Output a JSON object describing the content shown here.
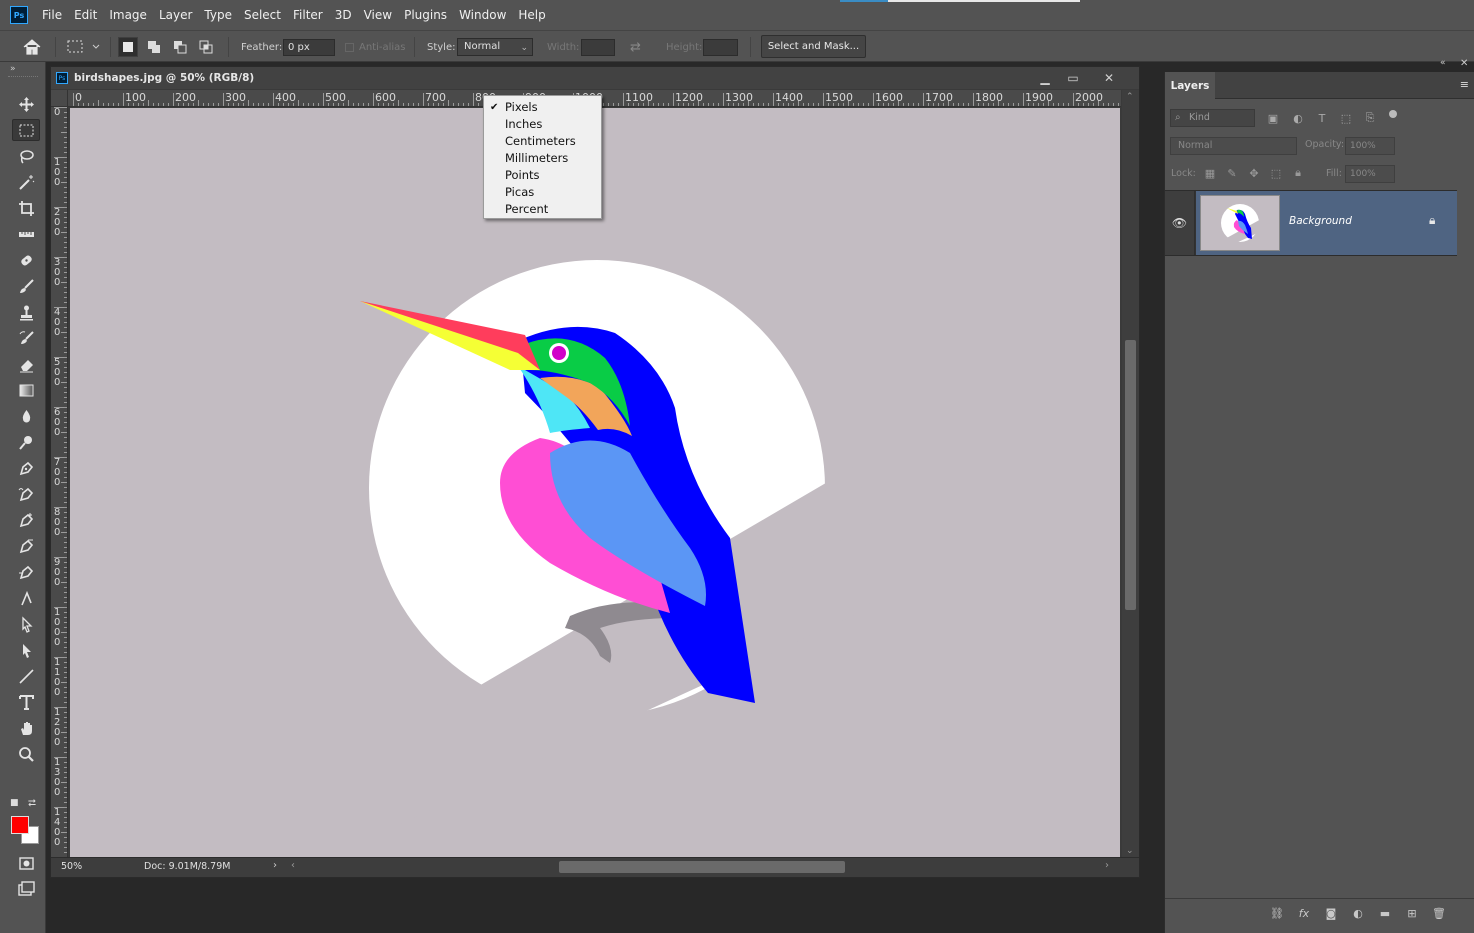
{
  "app": {
    "logo": "Ps"
  },
  "menu": [
    "File",
    "Edit",
    "Image",
    "Layer",
    "Type",
    "Select",
    "Filter",
    "3D",
    "View",
    "Plugins",
    "Window",
    "Help"
  ],
  "options": {
    "feather_label": "Feather:",
    "feather_value": "0 px",
    "antialias_label": "Anti-alias",
    "style_label": "Style:",
    "style_value": "Normal",
    "width_label": "Width:",
    "height_label": "Height:",
    "select_mask_label": "Select and Mask..."
  },
  "document": {
    "title": "birdshapes.jpg @ 50% (RGB/8)",
    "icon": "Ps",
    "zoom": "50%",
    "doc_size": "Doc: 9.01M/8.79M"
  },
  "ruler": {
    "top_labels": [
      "0",
      "100",
      "200",
      "300",
      "400",
      "500",
      "600",
      "700",
      "800",
      "900",
      "1000",
      "1100",
      "1200",
      "1300",
      "1400",
      "1500",
      "1600",
      "1700",
      "1800",
      "1900",
      "2000"
    ],
    "left_labels": [
      "0",
      "100",
      "200",
      "300",
      "400",
      "500",
      "600",
      "700",
      "800",
      "900",
      "1000",
      "1100",
      "1200",
      "1300",
      "1400"
    ]
  },
  "units_menu": {
    "items": [
      "Pixels",
      "Inches",
      "Centimeters",
      "Millimeters",
      "Points",
      "Picas",
      "Percent"
    ],
    "selected": "Pixels"
  },
  "layers_panel": {
    "tab": "Layers",
    "kind_placeholder": "Kind",
    "blend_mode": "Normal",
    "opacity_label": "Opacity:",
    "opacity_value": "100%",
    "lock_label": "Lock:",
    "fill_label": "Fill:",
    "fill_value": "100%",
    "layers": [
      {
        "name": "Background",
        "visible": true,
        "locked": true
      }
    ]
  },
  "colors": {
    "foreground": "#ff0000",
    "background": "#ffffff",
    "canvas_bg": "#c3bcc2",
    "layer_selected": "#4f6482"
  }
}
